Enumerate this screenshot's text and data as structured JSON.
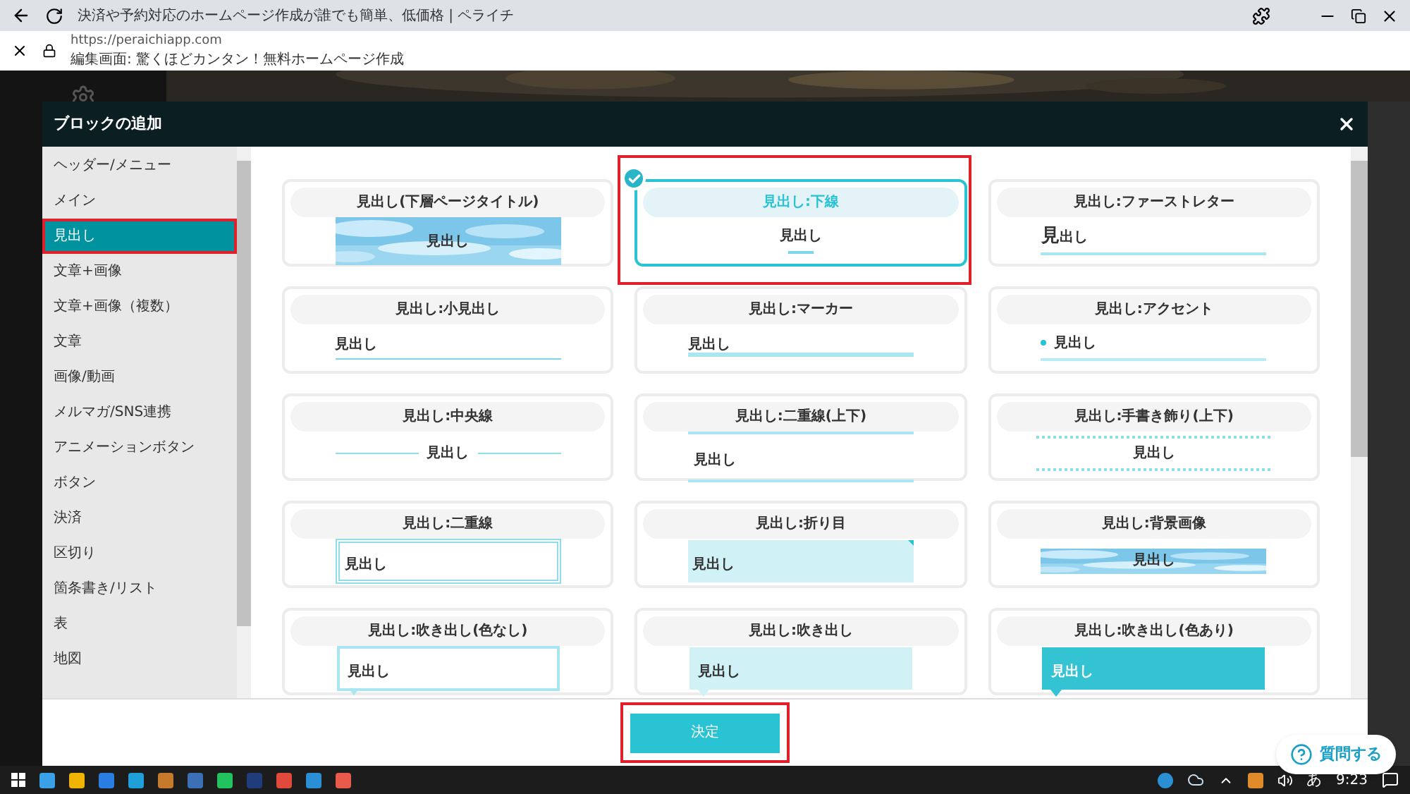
{
  "browser": {
    "tab_title": "決済や予約対応のホームページ作成が誰でも簡単、低価格 | ペライチ",
    "url": "https://peraichiapp.com",
    "page_title": "編集画面: 驚くほどカンタン！無料ホームページ作成"
  },
  "dialog": {
    "title": "ブロックの追加",
    "categories": [
      {
        "label": "ヘッダー/メニュー",
        "selected": false,
        "highlighted": false
      },
      {
        "label": "メイン",
        "selected": false,
        "highlighted": false
      },
      {
        "label": "見出し",
        "selected": true,
        "highlighted": true
      },
      {
        "label": "文章+画像",
        "selected": false,
        "highlighted": false
      },
      {
        "label": "文章+画像（複数）",
        "selected": false,
        "highlighted": false
      },
      {
        "label": "文章",
        "selected": false,
        "highlighted": false
      },
      {
        "label": "画像/動画",
        "selected": false,
        "highlighted": false
      },
      {
        "label": "メルマガ/SNS連携",
        "selected": false,
        "highlighted": false
      },
      {
        "label": "アニメーションボタン",
        "selected": false,
        "highlighted": false
      },
      {
        "label": "ボタン",
        "selected": false,
        "highlighted": false
      },
      {
        "label": "決済",
        "selected": false,
        "highlighted": false
      },
      {
        "label": "区切り",
        "selected": false,
        "highlighted": false
      },
      {
        "label": "箇条書き/リスト",
        "selected": false,
        "highlighted": false
      },
      {
        "label": "表",
        "selected": false,
        "highlighted": false
      },
      {
        "label": "地図",
        "selected": false,
        "highlighted": false
      }
    ],
    "blocks": [
      {
        "title": "見出し(下層ページタイトル)",
        "preview_text": "見出し",
        "selected": false,
        "highlighted": false
      },
      {
        "title": "見出し:下線",
        "kind": "underline",
        "preview_text": "見出し",
        "selected": true,
        "highlighted": true
      },
      {
        "title": "見出し:ファーストレター",
        "kind": "first_letter",
        "preview_text": "見出し",
        "selected": false,
        "highlighted": false
      },
      {
        "title": "見出し:小見出し",
        "kind": "small",
        "preview_text": "見出し",
        "selected": false,
        "highlighted": false
      },
      {
        "title": "見出し:マーカー",
        "kind": "marker",
        "preview_text": "見出し",
        "selected": false,
        "highlighted": false
      },
      {
        "title": "見出し:アクセント",
        "kind": "accent",
        "preview_text": "見出し",
        "selected": false,
        "highlighted": false
      },
      {
        "title": "見出し:中央線",
        "kind": "center_line",
        "preview_text": "見出し",
        "selected": false,
        "highlighted": false
      },
      {
        "title": "見出し:二重線(上下)",
        "kind": "double_lines",
        "preview_text": "見出し",
        "selected": false,
        "highlighted": false
      },
      {
        "title": "見出し:手書き飾り(上下)",
        "kind": "handwritten",
        "preview_text": "見出し",
        "selected": false,
        "highlighted": false
      },
      {
        "title": "見出し:二重線",
        "kind": "double_border",
        "preview_text": "見出し",
        "selected": false,
        "highlighted": false
      },
      {
        "title": "見出し:折り目",
        "kind": "fold",
        "preview_text": "見出し",
        "selected": false,
        "highlighted": false
      },
      {
        "title": "見出し:背景画像",
        "kind": "bg_image",
        "preview_text": "見出し",
        "selected": false,
        "highlighted": false
      },
      {
        "title": "見出し:吹き出し(色なし)",
        "kind": "bubble_outline",
        "preview_text": "見出し",
        "selected": false,
        "highlighted": false
      },
      {
        "title": "見出し:吹き出し",
        "kind": "bubble",
        "preview_text": "見出し",
        "selected": false,
        "highlighted": false
      },
      {
        "title": "見出し:吹き出し(色あり)",
        "kind": "bubble_filled",
        "preview_text": "見出し",
        "selected": false,
        "highlighted": false
      }
    ],
    "confirm_button": {
      "label": "決定",
      "highlighted": true
    }
  },
  "help_button": "質問する",
  "taskbar": {
    "ime": "あ",
    "time": "9:23"
  }
}
